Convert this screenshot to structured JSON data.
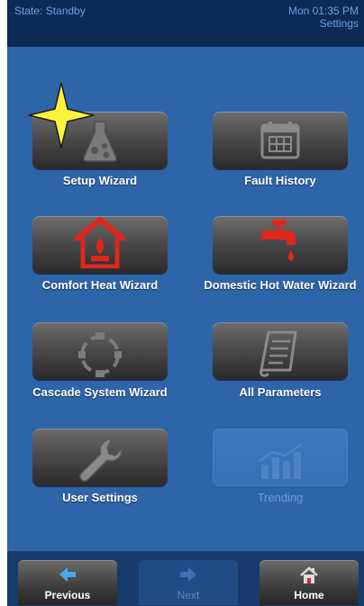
{
  "status": {
    "state": "State: Standby",
    "time": "Mon 01:35 PM",
    "screen": "Settings"
  },
  "tiles": [
    {
      "label": "Setup Wizard",
      "icon": "flask-icon"
    },
    {
      "label": "Fault History",
      "icon": "calendar-icon"
    },
    {
      "label": "Comfort Heat Wizard",
      "icon": "house-heat-icon"
    },
    {
      "label": "Domestic Hot Water Wizard",
      "icon": "faucet-icon"
    },
    {
      "label": "Cascade System Wizard",
      "icon": "cascade-icon"
    },
    {
      "label": "All Parameters",
      "icon": "document-icon"
    },
    {
      "label": "User Settings",
      "icon": "wrench-icon"
    },
    {
      "label": "Trending",
      "icon": "trend-chart-icon"
    }
  ],
  "nav": {
    "previous": "Previous",
    "next": "Next",
    "home": "Home"
  },
  "colors": {
    "background": "#2e64a8",
    "topbar": "#0b2a55",
    "heat_red": "#e0261b"
  }
}
